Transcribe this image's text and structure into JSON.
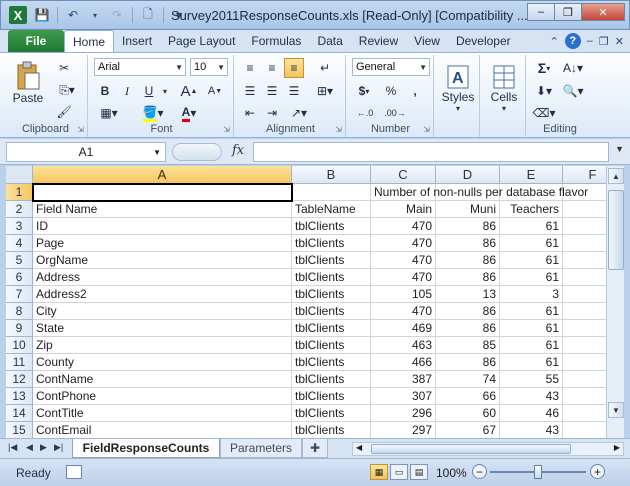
{
  "window": {
    "title": "Survey2011ResponseCounts.xls  [Read-Only]  [Compatibility ...",
    "minimize": "–",
    "restore": "❐",
    "close": "✕"
  },
  "qat": {
    "save": "💾",
    "undo": "↶",
    "redo": "↷",
    "new": "🗋",
    "more": "▾"
  },
  "ribbon_tabs": {
    "file": "File",
    "tabs": [
      "Home",
      "Insert",
      "Page Layout",
      "Formulas",
      "Data",
      "Review",
      "View",
      "Developer"
    ],
    "active": "Home"
  },
  "ribbon": {
    "clipboard": {
      "label": "Clipboard",
      "paste": "Paste"
    },
    "font": {
      "label": "Font",
      "name": "Arial",
      "size": "10",
      "bold": "B",
      "italic": "I",
      "underline": "U"
    },
    "alignment": {
      "label": "Alignment"
    },
    "number": {
      "label": "Number",
      "format": "General",
      "currency": "$",
      "percent": "%",
      "comma": ","
    },
    "styles": {
      "label": "Styles"
    },
    "cells": {
      "label": "Cells"
    },
    "editing": {
      "label": "Editing",
      "sum": "Σ"
    }
  },
  "formula_bar": {
    "name_box": "A1",
    "fx": "fx",
    "value": ""
  },
  "grid": {
    "columns": [
      {
        "id": "A",
        "selected": true
      },
      {
        "id": "B",
        "selected": false
      },
      {
        "id": "C",
        "selected": false
      },
      {
        "id": "D",
        "selected": false
      },
      {
        "id": "E",
        "selected": false
      },
      {
        "id": "F",
        "selected": false
      }
    ],
    "row1_header": "Number of non-nulls per database flavor",
    "rows": [
      {
        "n": "1",
        "a": "",
        "b": "",
        "c": "",
        "d": "",
        "e": ""
      },
      {
        "n": "2",
        "a": "Field Name",
        "b": "TableName",
        "c": "Main",
        "d": "Muni",
        "e": "Teachers"
      },
      {
        "n": "3",
        "a": "ID",
        "b": "tblClients",
        "c": "470",
        "d": "86",
        "e": "61"
      },
      {
        "n": "4",
        "a": "Page",
        "b": "tblClients",
        "c": "470",
        "d": "86",
        "e": "61"
      },
      {
        "n": "5",
        "a": "OrgName",
        "b": "tblClients",
        "c": "470",
        "d": "86",
        "e": "61"
      },
      {
        "n": "6",
        "a": "Address",
        "b": "tblClients",
        "c": "470",
        "d": "86",
        "e": "61"
      },
      {
        "n": "7",
        "a": "Address2",
        "b": "tblClients",
        "c": "105",
        "d": "13",
        "e": "3"
      },
      {
        "n": "8",
        "a": "City",
        "b": "tblClients",
        "c": "470",
        "d": "86",
        "e": "61"
      },
      {
        "n": "9",
        "a": "State",
        "b": "tblClients",
        "c": "469",
        "d": "86",
        "e": "61"
      },
      {
        "n": "10",
        "a": "Zip",
        "b": "tblClients",
        "c": "463",
        "d": "85",
        "e": "61"
      },
      {
        "n": "11",
        "a": "County",
        "b": "tblClients",
        "c": "466",
        "d": "86",
        "e": "61"
      },
      {
        "n": "12",
        "a": "ContName",
        "b": "tblClients",
        "c": "387",
        "d": "74",
        "e": "55"
      },
      {
        "n": "13",
        "a": "ContPhone",
        "b": "tblClients",
        "c": "307",
        "d": "66",
        "e": "43"
      },
      {
        "n": "14",
        "a": "ContTitle",
        "b": "tblClients",
        "c": "296",
        "d": "60",
        "e": "46"
      },
      {
        "n": "15",
        "a": "ContEmail",
        "b": "tblClients",
        "c": "297",
        "d": "67",
        "e": "43"
      }
    ]
  },
  "sheets": {
    "active": "FieldResponseCounts",
    "other": "Parameters"
  },
  "status": {
    "ready": "Ready",
    "zoom": "100%",
    "zoom_minus": "−",
    "zoom_plus": "+"
  }
}
